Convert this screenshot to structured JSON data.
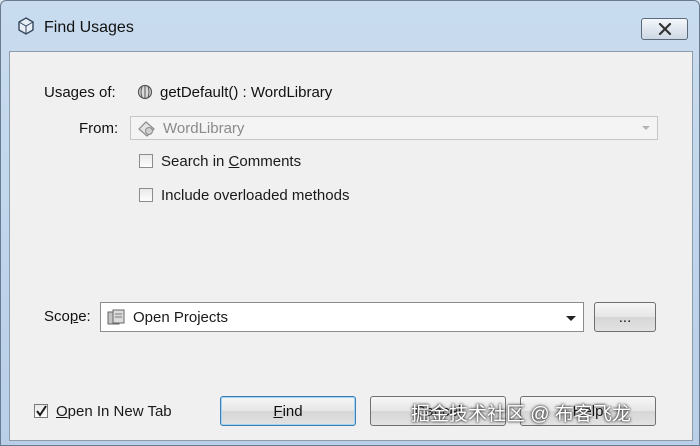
{
  "window": {
    "title": "Find Usages",
    "icon": "netbeans-cube-icon"
  },
  "usages": {
    "label": "Usages of:",
    "method": "getDefault() : WordLibrary",
    "icon": "method-icon"
  },
  "from": {
    "label": "From:",
    "value": "WordLibrary",
    "icon": "class-icon",
    "enabled": false
  },
  "options": {
    "search_comments": {
      "label": "Search in Comments",
      "checked": false
    },
    "overloaded": {
      "label": "Include overloaded methods",
      "checked": false
    }
  },
  "scope": {
    "label": "Scope:",
    "value": "Open Projects",
    "icon": "projects-icon",
    "browse_label": "..."
  },
  "footer": {
    "open_new_tab": {
      "label": "Open In New Tab",
      "checked": true
    },
    "find_label": "Find",
    "cancel_label": "Cancel",
    "help_label": "Help"
  },
  "watermark": "掘金技术社区 @ 布客飞龙"
}
